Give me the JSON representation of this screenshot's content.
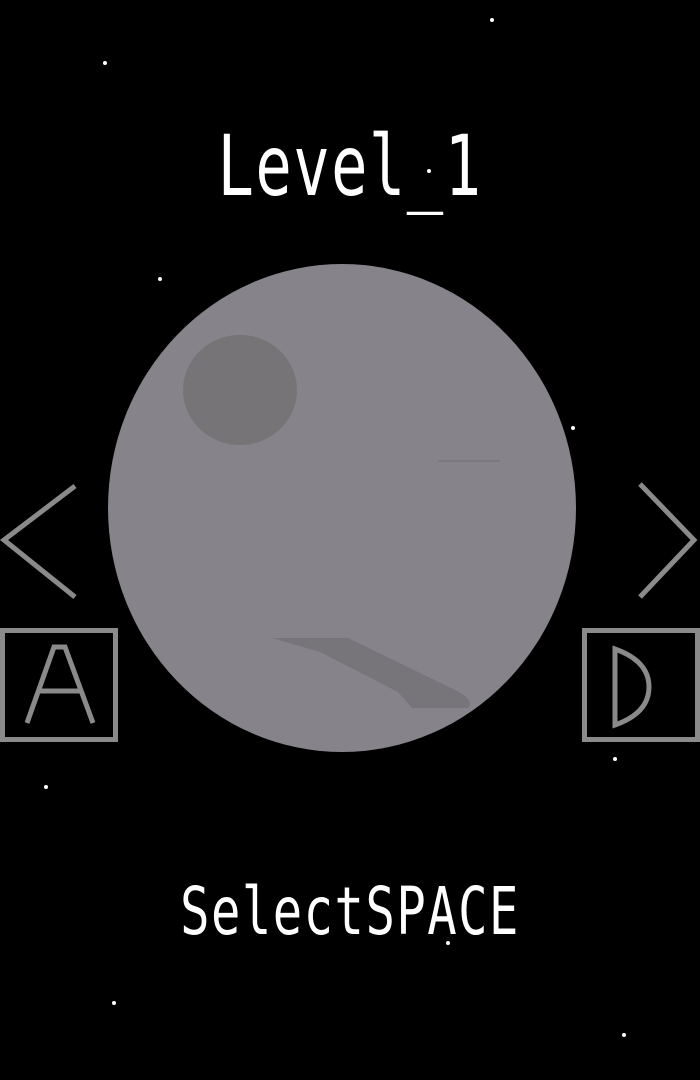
{
  "level": {
    "title": "Level_1"
  },
  "controls": {
    "left_key": "A",
    "right_key": "D",
    "left_arrow_icon": "chevron-left-icon",
    "right_arrow_icon": "chevron-right-icon"
  },
  "hint": {
    "text": "SelectSPACE"
  },
  "colors": {
    "background": "#000000",
    "text": "#ffffff",
    "planet": "#86838a",
    "crater": "#777478",
    "ui_gray": "#8a8a8a"
  }
}
